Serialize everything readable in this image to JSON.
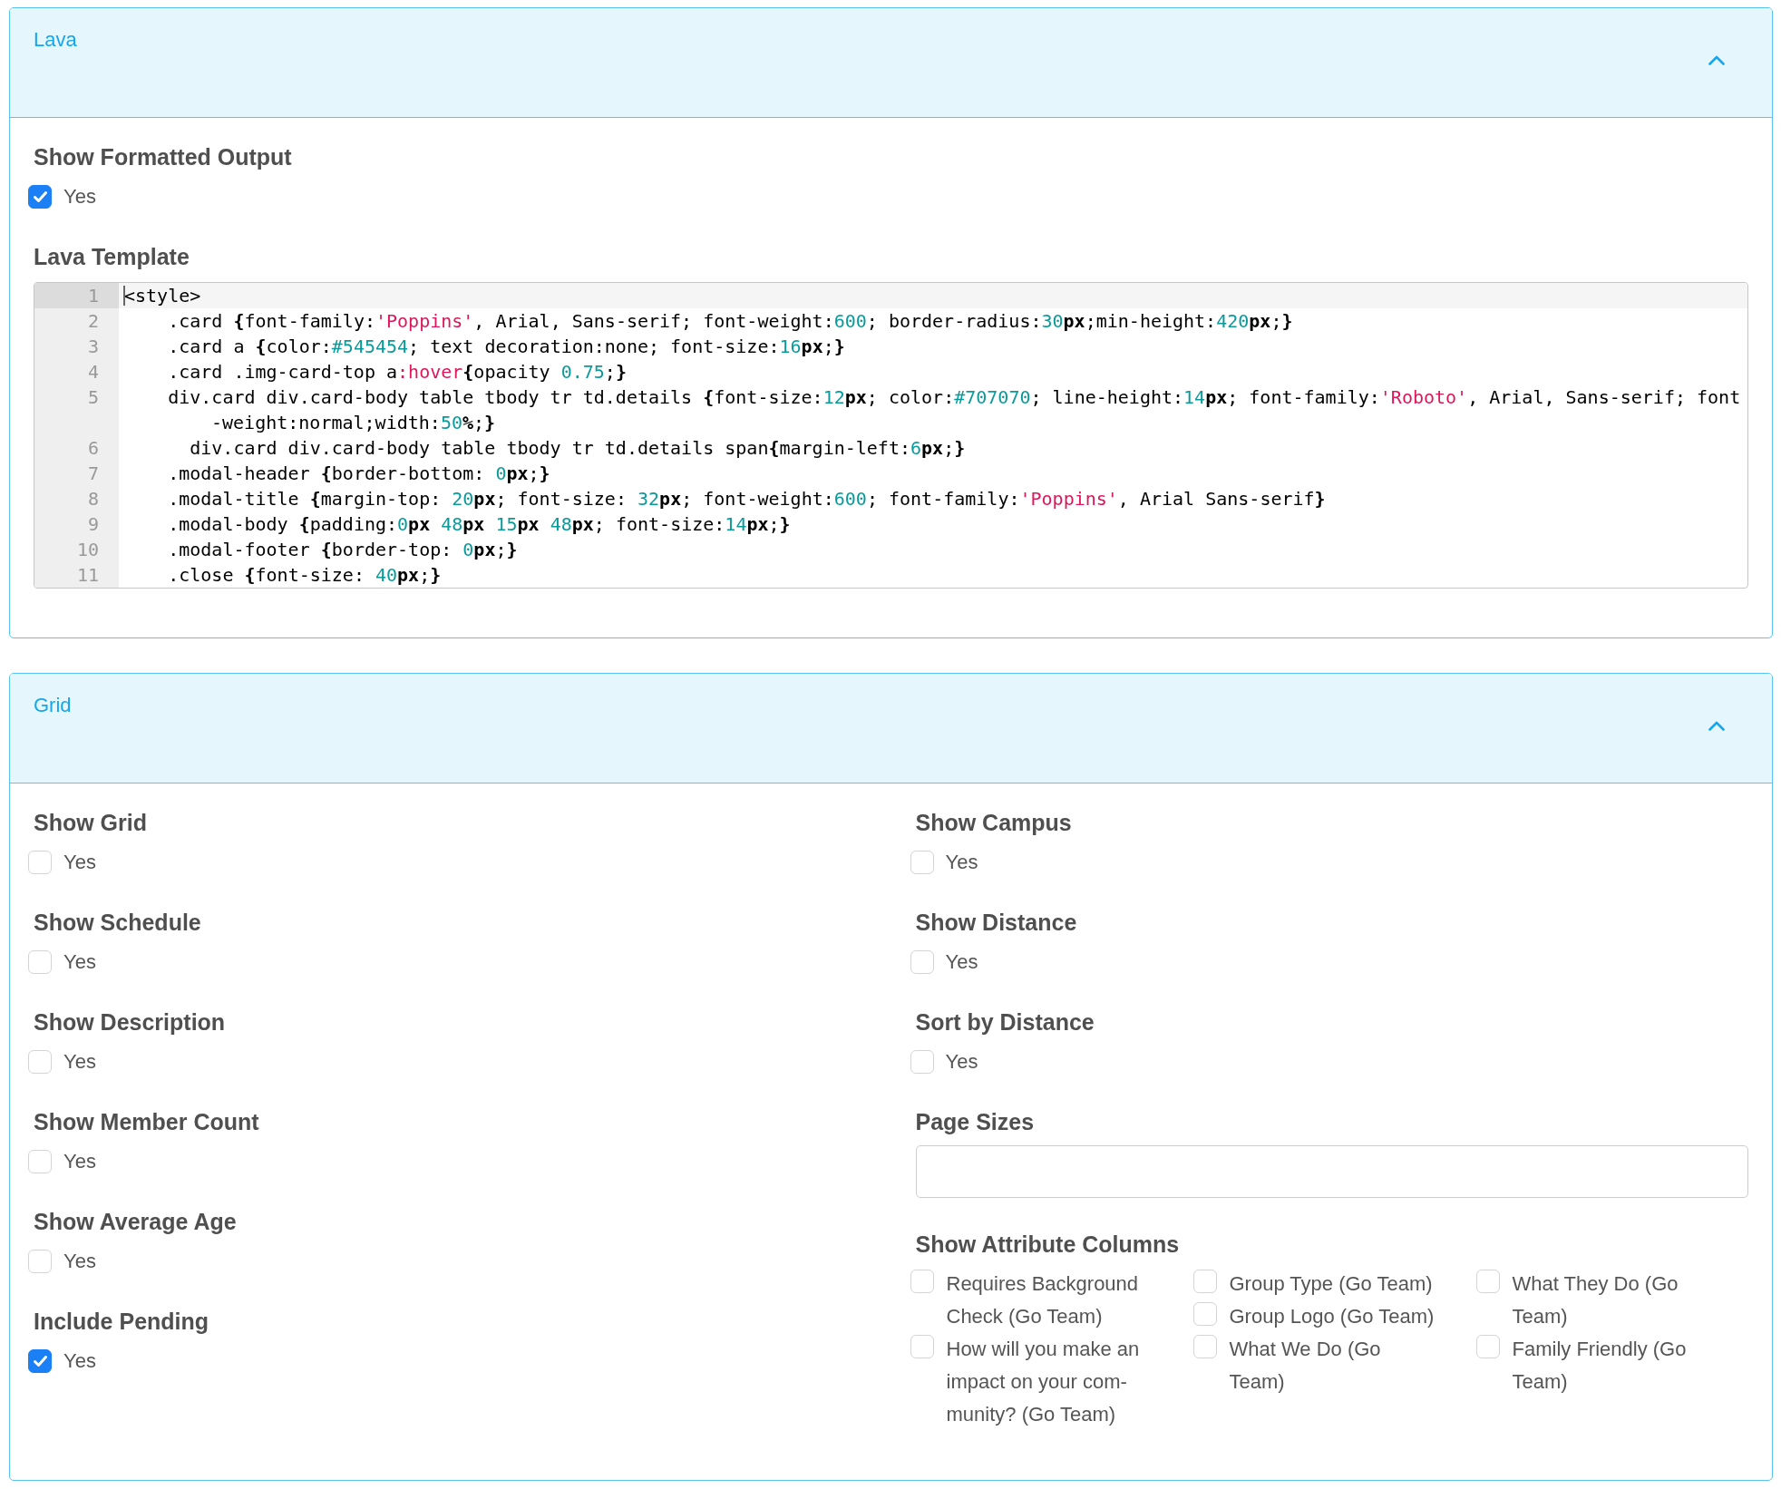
{
  "panels": [
    {
      "title": "Lava",
      "expanded": true,
      "columns": [
        [
          {
            "kind": "checkbox",
            "label": "Show Formatted Output",
            "option": "Yes",
            "checked": true
          },
          {
            "kind": "code",
            "label": "Lava Template",
            "lines": [
              {
                "number": "1",
                "active": true,
                "tokens": [
                  {
                    "kind": "plain",
                    "text": "<style>"
                  }
                ]
              },
              {
                "number": "2",
                "active": false,
                "tokens": [
                  {
                    "kind": "plain",
                    "text": "    .card "
                  },
                  {
                    "kind": "strong",
                    "text": "{"
                  },
                  {
                    "kind": "plain",
                    "text": "font-family:"
                  },
                  {
                    "kind": "string",
                    "text": "'Poppins'"
                  },
                  {
                    "kind": "plain",
                    "text": ", Arial, Sans-serif; font-weight:"
                  },
                  {
                    "kind": "number",
                    "text": "600"
                  },
                  {
                    "kind": "plain",
                    "text": "; border-radius:"
                  },
                  {
                    "kind": "number",
                    "text": "30"
                  },
                  {
                    "kind": "strong",
                    "text": "px"
                  },
                  {
                    "kind": "plain",
                    "text": ";min-height:"
                  },
                  {
                    "kind": "number",
                    "text": "420"
                  },
                  {
                    "kind": "strong",
                    "text": "px"
                  },
                  {
                    "kind": "plain",
                    "text": ";"
                  },
                  {
                    "kind": "strong",
                    "text": "}"
                  }
                ]
              },
              {
                "number": "3",
                "active": false,
                "tokens": [
                  {
                    "kind": "plain",
                    "text": "    .card a "
                  },
                  {
                    "kind": "strong",
                    "text": "{"
                  },
                  {
                    "kind": "plain",
                    "text": "color:"
                  },
                  {
                    "kind": "number",
                    "text": "#545454"
                  },
                  {
                    "kind": "plain",
                    "text": "; text decoration:none; font-size:"
                  },
                  {
                    "kind": "number",
                    "text": "16"
                  },
                  {
                    "kind": "strong",
                    "text": "px"
                  },
                  {
                    "kind": "plain",
                    "text": ";"
                  },
                  {
                    "kind": "strong",
                    "text": "}"
                  }
                ]
              },
              {
                "number": "4",
                "active": false,
                "tokens": [
                  {
                    "kind": "plain",
                    "text": "    .card .img-card-top a"
                  },
                  {
                    "kind": "pseudo",
                    "text": ":hover"
                  },
                  {
                    "kind": "strong",
                    "text": "{"
                  },
                  {
                    "kind": "plain",
                    "text": "opacity "
                  },
                  {
                    "kind": "number",
                    "text": "0.75"
                  },
                  {
                    "kind": "plain",
                    "text": ";"
                  },
                  {
                    "kind": "strong",
                    "text": "}"
                  }
                ]
              },
              {
                "number": "5",
                "active": false,
                "tokens": [
                  {
                    "kind": "plain",
                    "text": "    div.card div.card-body table tbody tr td.details "
                  },
                  {
                    "kind": "strong",
                    "text": "{"
                  },
                  {
                    "kind": "plain",
                    "text": "font-size:"
                  },
                  {
                    "kind": "number",
                    "text": "12"
                  },
                  {
                    "kind": "strong",
                    "text": "px"
                  },
                  {
                    "kind": "plain",
                    "text": "; color:"
                  },
                  {
                    "kind": "number",
                    "text": "#707070"
                  },
                  {
                    "kind": "plain",
                    "text": "; line-height:"
                  },
                  {
                    "kind": "number",
                    "text": "14"
                  },
                  {
                    "kind": "strong",
                    "text": "px"
                  },
                  {
                    "kind": "plain",
                    "text": "; font-family:"
                  },
                  {
                    "kind": "string",
                    "text": "'Roboto'"
                  },
                  {
                    "kind": "plain",
                    "text": ", Arial, Sans-serif; font"
                  }
                ],
                "continuation": {
                  "tokens": [
                    {
                      "kind": "plain",
                      "text": "-weight:normal;width:"
                    },
                    {
                      "kind": "number",
                      "text": "50"
                    },
                    {
                      "kind": "strong",
                      "text": "%"
                    },
                    {
                      "kind": "plain",
                      "text": ";"
                    },
                    {
                      "kind": "strong",
                      "text": "}"
                    }
                  ]
                }
              },
              {
                "number": "6",
                "active": false,
                "tokens": [
                  {
                    "kind": "plain",
                    "text": "      div.card div.card-body table tbody tr td.details span"
                  },
                  {
                    "kind": "strong",
                    "text": "{"
                  },
                  {
                    "kind": "plain",
                    "text": "margin-left:"
                  },
                  {
                    "kind": "number",
                    "text": "6"
                  },
                  {
                    "kind": "strong",
                    "text": "px"
                  },
                  {
                    "kind": "plain",
                    "text": ";"
                  },
                  {
                    "kind": "strong",
                    "text": "}"
                  }
                ]
              },
              {
                "number": "7",
                "active": false,
                "tokens": [
                  {
                    "kind": "plain",
                    "text": "    .modal-header "
                  },
                  {
                    "kind": "strong",
                    "text": "{"
                  },
                  {
                    "kind": "plain",
                    "text": "border-bottom: "
                  },
                  {
                    "kind": "number",
                    "text": "0"
                  },
                  {
                    "kind": "strong",
                    "text": "px"
                  },
                  {
                    "kind": "plain",
                    "text": ";"
                  },
                  {
                    "kind": "strong",
                    "text": "}"
                  }
                ]
              },
              {
                "number": "8",
                "active": false,
                "tokens": [
                  {
                    "kind": "plain",
                    "text": "    .modal-title "
                  },
                  {
                    "kind": "strong",
                    "text": "{"
                  },
                  {
                    "kind": "plain",
                    "text": "margin-top: "
                  },
                  {
                    "kind": "number",
                    "text": "20"
                  },
                  {
                    "kind": "strong",
                    "text": "px"
                  },
                  {
                    "kind": "plain",
                    "text": "; font-size: "
                  },
                  {
                    "kind": "number",
                    "text": "32"
                  },
                  {
                    "kind": "strong",
                    "text": "px"
                  },
                  {
                    "kind": "plain",
                    "text": "; font-weight:"
                  },
                  {
                    "kind": "number",
                    "text": "600"
                  },
                  {
                    "kind": "plain",
                    "text": "; font-family:"
                  },
                  {
                    "kind": "string",
                    "text": "'Poppins'"
                  },
                  {
                    "kind": "plain",
                    "text": ", Arial Sans-serif"
                  },
                  {
                    "kind": "strong",
                    "text": "}"
                  }
                ]
              },
              {
                "number": "9",
                "active": false,
                "tokens": [
                  {
                    "kind": "plain",
                    "text": "    .modal-body "
                  },
                  {
                    "kind": "strong",
                    "text": "{"
                  },
                  {
                    "kind": "plain",
                    "text": "padding:"
                  },
                  {
                    "kind": "number",
                    "text": "0"
                  },
                  {
                    "kind": "strong",
                    "text": "px "
                  },
                  {
                    "kind": "number",
                    "text": "48"
                  },
                  {
                    "kind": "strong",
                    "text": "px "
                  },
                  {
                    "kind": "number",
                    "text": "15"
                  },
                  {
                    "kind": "strong",
                    "text": "px "
                  },
                  {
                    "kind": "number",
                    "text": "48"
                  },
                  {
                    "kind": "strong",
                    "text": "px"
                  },
                  {
                    "kind": "plain",
                    "text": "; font-size:"
                  },
                  {
                    "kind": "number",
                    "text": "14"
                  },
                  {
                    "kind": "strong",
                    "text": "px"
                  },
                  {
                    "kind": "plain",
                    "text": ";"
                  },
                  {
                    "kind": "strong",
                    "text": "}"
                  }
                ]
              },
              {
                "number": "10",
                "active": false,
                "tokens": [
                  {
                    "kind": "plain",
                    "text": "    .modal-footer "
                  },
                  {
                    "kind": "strong",
                    "text": "{"
                  },
                  {
                    "kind": "plain",
                    "text": "border-top: "
                  },
                  {
                    "kind": "number",
                    "text": "0"
                  },
                  {
                    "kind": "strong",
                    "text": "px"
                  },
                  {
                    "kind": "plain",
                    "text": ";"
                  },
                  {
                    "kind": "strong",
                    "text": "}"
                  }
                ]
              },
              {
                "number": "11",
                "active": false,
                "tokens": [
                  {
                    "kind": "plain",
                    "text": "    .close "
                  },
                  {
                    "kind": "strong",
                    "text": "{"
                  },
                  {
                    "kind": "plain",
                    "text": "font-size: "
                  },
                  {
                    "kind": "number",
                    "text": "40"
                  },
                  {
                    "kind": "strong",
                    "text": "px"
                  },
                  {
                    "kind": "plain",
                    "text": ";"
                  },
                  {
                    "kind": "strong",
                    "text": "}"
                  }
                ]
              }
            ]
          }
        ]
      ]
    },
    {
      "title": "Grid",
      "expanded": true,
      "columns": [
        [
          {
            "kind": "checkbox",
            "label": "Show Grid",
            "option": "Yes",
            "checked": false
          },
          {
            "kind": "checkbox",
            "label": "Show Schedule",
            "option": "Yes",
            "checked": false
          },
          {
            "kind": "checkbox",
            "label": "Show Description",
            "option": "Yes",
            "checked": false
          },
          {
            "kind": "checkbox",
            "label": "Show Member Count",
            "option": "Yes",
            "checked": false
          },
          {
            "kind": "checkbox",
            "label": "Show Average Age",
            "option": "Yes",
            "checked": false
          },
          {
            "kind": "checkbox",
            "label": "Include Pending",
            "option": "Yes",
            "checked": true
          }
        ],
        [
          {
            "kind": "checkbox",
            "label": "Show Campus",
            "option": "Yes",
            "checked": false
          },
          {
            "kind": "checkbox",
            "label": "Show Distance",
            "option": "Yes",
            "checked": false
          },
          {
            "kind": "checkbox",
            "label": "Sort by Distance",
            "option": "Yes",
            "checked": false
          },
          {
            "kind": "text_input",
            "label": "Page Sizes"
          },
          {
            "kind": "checkbox_list",
            "label": "Show Attribute Columns",
            "option_columns": [
              {
                "options": [
                  {
                    "label": "Requires Background Check (Go Team)",
                    "checked": false
                  },
                  {
                    "label": "How will you make an impact on your com-munity? (Go Team)",
                    "checked": false
                  }
                ]
              },
              {
                "options": [
                  {
                    "label": "Group Type (Go Team)",
                    "checked": false
                  },
                  {
                    "label": "Group Logo (Go Team)",
                    "checked": false
                  },
                  {
                    "label": "What We Do (Go Team)",
                    "checked": false
                  }
                ]
              },
              {
                "options": [
                  {
                    "label": "What They Do (Go Team)",
                    "checked": false
                  },
                  {
                    "label": "Family Friendly (Go Team)",
                    "checked": false
                  }
                ]
              }
            ]
          }
        ]
      ]
    }
  ]
}
